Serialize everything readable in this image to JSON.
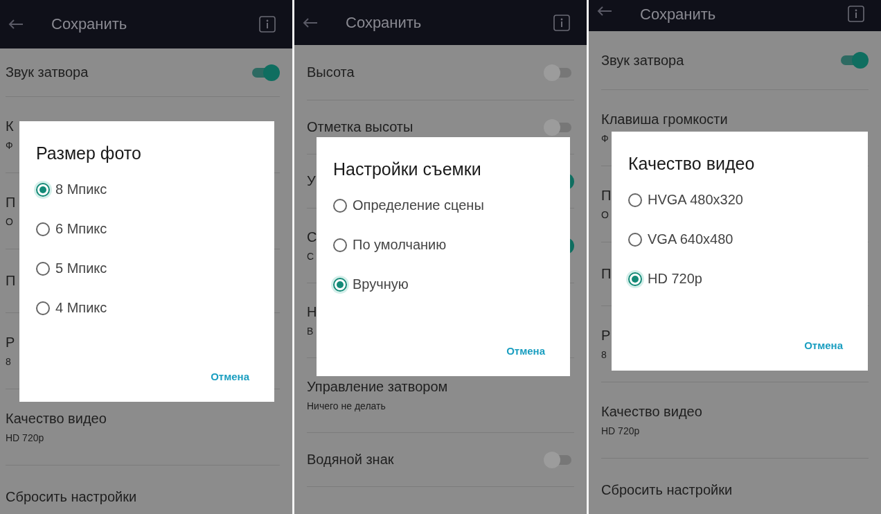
{
  "panels": [
    {
      "header": {
        "title": "Сохранить"
      },
      "rows": [
        {
          "kind": "toggle",
          "title": "Звук затвора",
          "on": true
        },
        {
          "kind": "text",
          "title": "К",
          "subtitle": "Ф"
        },
        {
          "kind": "text",
          "title": "П",
          "subtitle": "О"
        },
        {
          "kind": "text",
          "title": "П"
        },
        {
          "kind": "text",
          "title": "Р",
          "subtitle": "8"
        },
        {
          "kind": "text",
          "title": "Качество видео",
          "subtitle": "HD 720p"
        },
        {
          "kind": "text",
          "title": "Сбросить настройки"
        }
      ],
      "dialog": {
        "title": "Размер фото",
        "options": [
          {
            "label": "8 Мпикс",
            "selected": true
          },
          {
            "label": "6 Мпикс",
            "selected": false
          },
          {
            "label": "5 Мпикс",
            "selected": false
          },
          {
            "label": "4 Мпикс",
            "selected": false
          }
        ],
        "cancel": "Отмена"
      }
    },
    {
      "header": {
        "title": "Сохранить"
      },
      "rows": [
        {
          "kind": "toggle",
          "title": "Высота",
          "on": false
        },
        {
          "kind": "toggle",
          "title": "Отметка высоты",
          "on": false
        },
        {
          "kind": "toggle",
          "title": "У",
          "on": true
        },
        {
          "kind": "toggle",
          "title": "С",
          "subtitle": "С",
          "on": true
        },
        {
          "kind": "text",
          "title": "Н",
          "subtitle": "В"
        },
        {
          "kind": "text",
          "title": "Управление затвором",
          "subtitle": "Ничего не делать"
        },
        {
          "kind": "toggle",
          "title": "Водяной знак",
          "on": false
        }
      ],
      "dialog": {
        "title": "Настройки съемки",
        "options": [
          {
            "label": "Определение сцены",
            "selected": false
          },
          {
            "label": "По умолчанию",
            "selected": false
          },
          {
            "label": "Вручную",
            "selected": true
          }
        ],
        "cancel": "Отмена"
      }
    },
    {
      "header": {
        "title": "Сохранить"
      },
      "rows": [
        {
          "kind": "toggle",
          "title": "Звук затвора",
          "on": true
        },
        {
          "kind": "text",
          "title": "Клавиша громкости",
          "subtitle": "Ф"
        },
        {
          "kind": "text",
          "title": "П",
          "subtitle": "О"
        },
        {
          "kind": "text",
          "title": "П"
        },
        {
          "kind": "text",
          "title": "Р",
          "subtitle": "8"
        },
        {
          "kind": "text",
          "title": "Качество видео",
          "subtitle": "HD 720p"
        },
        {
          "kind": "text",
          "title": "Сбросить настройки"
        }
      ],
      "dialog": {
        "title": "Качество видео",
        "options": [
          {
            "label": "HVGA 480x320",
            "selected": false
          },
          {
            "label": "VGA 640x480",
            "selected": false
          },
          {
            "label": "HD 720p",
            "selected": true
          }
        ],
        "cancel": "Отмена"
      }
    }
  ]
}
